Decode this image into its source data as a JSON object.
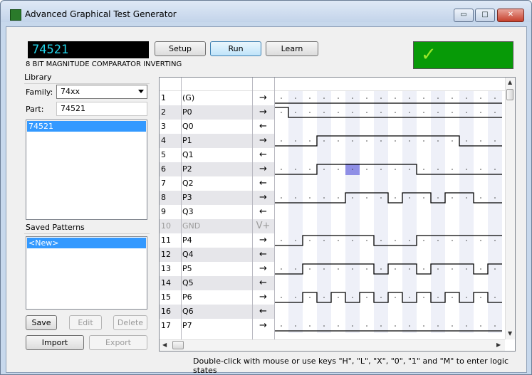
{
  "window": {
    "title": "Advanced Graphical Test Generator",
    "min_glyph": "▭",
    "max_glyph": "□",
    "close_glyph": "✕"
  },
  "part_display": "74521",
  "description": "8 BIT MAGNITUDE COMPARATOR INVERTING",
  "toolbar": {
    "setup": "Setup",
    "run": "Run",
    "learn": "Learn"
  },
  "status": {
    "icon": "check-icon",
    "glyph": "✓",
    "color": "#079a07"
  },
  "library": {
    "heading": "Library",
    "family_label": "Family:",
    "family_value": "74xx",
    "part_label": "Part:",
    "part_value": "74521",
    "parts": [
      "74521"
    ]
  },
  "saved_patterns": {
    "heading": "Saved Patterns",
    "items": [
      "<New>"
    ],
    "buttons": {
      "save": "Save",
      "edit": "Edit",
      "delete": "Delete",
      "import": "Import",
      "export": "Export"
    }
  },
  "pins": [
    {
      "num": "1",
      "name": "(G)",
      "dir": "→",
      "wave": [
        0,
        0,
        0,
        0,
        0,
        0,
        0,
        0,
        0,
        0,
        0,
        0,
        0,
        0,
        0,
        0
      ]
    },
    {
      "num": "2",
      "name": "P0",
      "dir": "→",
      "wave": [
        1,
        0,
        0,
        0,
        0,
        0,
        0,
        0,
        0,
        0,
        0,
        0,
        0,
        0,
        0,
        0
      ]
    },
    {
      "num": "3",
      "name": "Q0",
      "dir": "←",
      "wave": []
    },
    {
      "num": "4",
      "name": "P1",
      "dir": "→",
      "wave": [
        0,
        0,
        0,
        1,
        1,
        1,
        1,
        1,
        1,
        1,
        1,
        1,
        1,
        0,
        0,
        0
      ]
    },
    {
      "num": "5",
      "name": "Q1",
      "dir": "←",
      "wave": []
    },
    {
      "num": "6",
      "name": "P2",
      "dir": "→",
      "wave": [
        0,
        0,
        0,
        1,
        1,
        1,
        1,
        1,
        1,
        1,
        0,
        0,
        0,
        0,
        0,
        0
      ],
      "highlight": 5
    },
    {
      "num": "7",
      "name": "Q2",
      "dir": "←",
      "wave": []
    },
    {
      "num": "8",
      "name": "P3",
      "dir": "→",
      "wave": [
        0,
        0,
        0,
        0,
        0,
        1,
        1,
        1,
        0,
        1,
        1,
        0,
        1,
        1,
        0,
        0
      ]
    },
    {
      "num": "9",
      "name": "Q3",
      "dir": "←",
      "wave": []
    },
    {
      "num": "10",
      "name": "GND",
      "dir": "V+",
      "wave": [],
      "disabled": true
    },
    {
      "num": "11",
      "name": "P4",
      "dir": "→",
      "wave": [
        0,
        0,
        1,
        1,
        1,
        1,
        1,
        0,
        0,
        0,
        1,
        1,
        1,
        1,
        1,
        1
      ]
    },
    {
      "num": "12",
      "name": "Q4",
      "dir": "←",
      "wave": []
    },
    {
      "num": "13",
      "name": "P5",
      "dir": "→",
      "wave": [
        0,
        0,
        1,
        1,
        1,
        1,
        1,
        0,
        1,
        1,
        0,
        1,
        1,
        1,
        0,
        1
      ]
    },
    {
      "num": "14",
      "name": "Q5",
      "dir": "←",
      "wave": []
    },
    {
      "num": "15",
      "name": "P6",
      "dir": "→",
      "wave": [
        0,
        0,
        1,
        0,
        1,
        0,
        1,
        0,
        1,
        0,
        1,
        0,
        1,
        0,
        1,
        0
      ]
    },
    {
      "num": "16",
      "name": "Q6",
      "dir": "←",
      "wave": []
    },
    {
      "num": "17",
      "name": "P7",
      "dir": "→",
      "wave": [
        0,
        0,
        0,
        0,
        0,
        0,
        0,
        0,
        0,
        0,
        0,
        0,
        0,
        0,
        0,
        0
      ]
    }
  ],
  "hint": "Double-click with mouse or use keys \"H\", \"L\", \"X\", \"0\", \"1\" and \"M\" to enter logic states"
}
